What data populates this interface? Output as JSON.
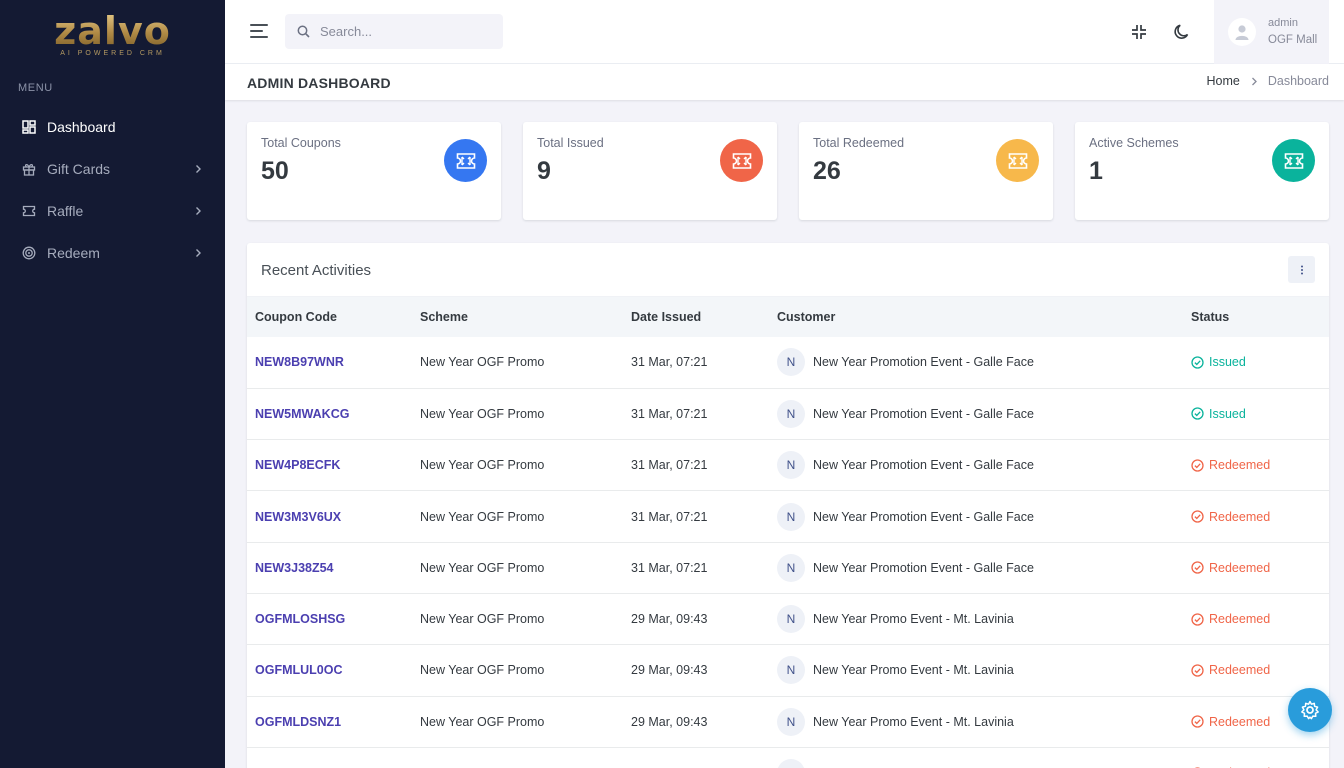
{
  "brand": {
    "name": "zalvo",
    "tagline": "AI POWERED CRM"
  },
  "sidebar": {
    "menu_title": "MENU",
    "items": [
      {
        "label": "Dashboard",
        "icon": "dashboard-icon",
        "active": true
      },
      {
        "label": "Gift Cards",
        "icon": "gift-icon",
        "has_submenu": true
      },
      {
        "label": "Raffle",
        "icon": "ticket-icon",
        "has_submenu": true
      },
      {
        "label": "Redeem",
        "icon": "target-icon",
        "has_submenu": true
      }
    ]
  },
  "topbar": {
    "search": {
      "placeholder": "Search..."
    },
    "user": {
      "name": "admin",
      "org": "OGF Mall"
    }
  },
  "page": {
    "title": "ADMIN DASHBOARD",
    "breadcrumb": {
      "home": "Home",
      "current": "Dashboard"
    }
  },
  "stats": [
    {
      "label": "Total Coupons",
      "value": "50",
      "color": "#3577f1"
    },
    {
      "label": "Total Issued",
      "value": "9",
      "color": "#f06548"
    },
    {
      "label": "Total Redeemed",
      "value": "26",
      "color": "#f7b84b"
    },
    {
      "label": "Active Schemes",
      "value": "1",
      "color": "#0ab39c"
    }
  ],
  "activities": {
    "title": "Recent Activities",
    "columns": [
      "Coupon Code",
      "Scheme",
      "Date Issued",
      "Customer",
      "Status"
    ],
    "rows": [
      {
        "code": "NEW8B97WNR",
        "scheme": "New Year OGF Promo",
        "date": "31 Mar, 07:21",
        "avatar": "N",
        "customer": "New Year Promotion Event - Galle Face",
        "status": "Issued"
      },
      {
        "code": "NEW5MWAKCG",
        "scheme": "New Year OGF Promo",
        "date": "31 Mar, 07:21",
        "avatar": "N",
        "customer": "New Year Promotion Event - Galle Face",
        "status": "Issued"
      },
      {
        "code": "NEW4P8ECFK",
        "scheme": "New Year OGF Promo",
        "date": "31 Mar, 07:21",
        "avatar": "N",
        "customer": "New Year Promotion Event - Galle Face",
        "status": "Redeemed"
      },
      {
        "code": "NEW3M3V6UX",
        "scheme": "New Year OGF Promo",
        "date": "31 Mar, 07:21",
        "avatar": "N",
        "customer": "New Year Promotion Event - Galle Face",
        "status": "Redeemed"
      },
      {
        "code": "NEW3J38Z54",
        "scheme": "New Year OGF Promo",
        "date": "31 Mar, 07:21",
        "avatar": "N",
        "customer": "New Year Promotion Event - Galle Face",
        "status": "Redeemed"
      },
      {
        "code": "OGFMLOSHSG",
        "scheme": "New Year OGF Promo",
        "date": "29 Mar, 09:43",
        "avatar": "N",
        "customer": "New Year Promo Event - Mt. Lavinia",
        "status": "Redeemed"
      },
      {
        "code": "OGFMLUL0OC",
        "scheme": "New Year OGF Promo",
        "date": "29 Mar, 09:43",
        "avatar": "N",
        "customer": "New Year Promo Event - Mt. Lavinia",
        "status": "Redeemed"
      },
      {
        "code": "OGFMLDSNZ1",
        "scheme": "New Year OGF Promo",
        "date": "29 Mar, 09:43",
        "avatar": "N",
        "customer": "New Year Promo Event - Mt. Lavinia",
        "status": "Redeemed"
      },
      {
        "code": "",
        "scheme": "",
        "date": "",
        "avatar": "",
        "customer": "",
        "status": "Redeemed"
      }
    ]
  }
}
